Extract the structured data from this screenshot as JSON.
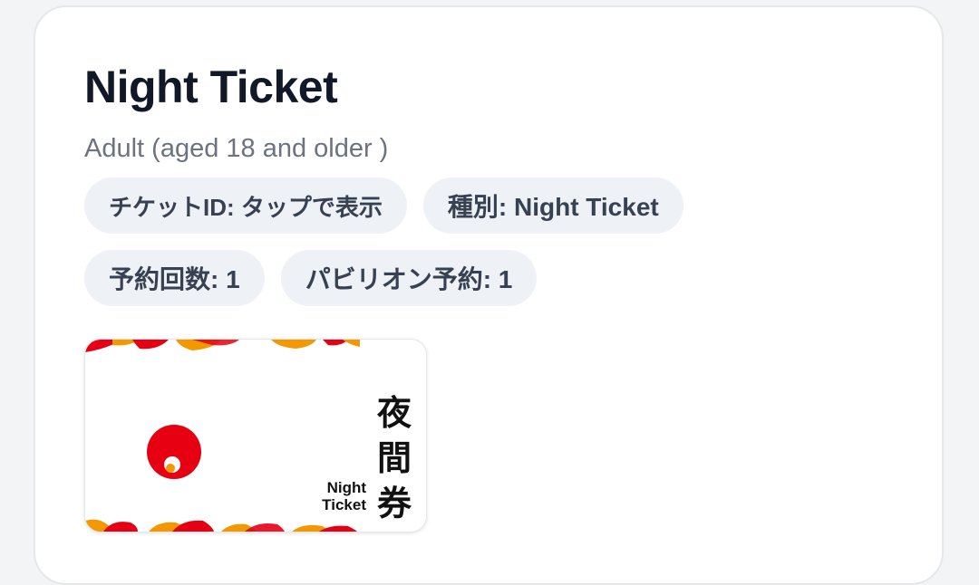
{
  "ticket": {
    "title": "Night Ticket",
    "subtitle": "Adult (aged 18 and older )",
    "chips": {
      "ticket_id": "チケットID: タップで表示",
      "type": "種別: Night Ticket",
      "reservations": "予約回数: 1",
      "pavilion": "パビリオン予約: 1"
    },
    "image": {
      "kanji": [
        "夜",
        "間",
        "券"
      ],
      "label_line1": "Night",
      "label_line2": "Ticket"
    }
  },
  "colors": {
    "accent_red": "#e60012",
    "accent_orange": "#f39800",
    "chip_bg": "#eef1f5",
    "title": "#111827"
  }
}
